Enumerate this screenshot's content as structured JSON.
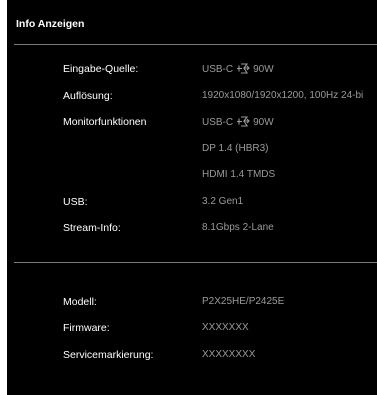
{
  "title": "Info Anzeigen",
  "rows": [
    {
      "label": "Eingabe-Quelle:",
      "value_prefix": "USB-C",
      "icon": "usb-c-power-icon",
      "value_suffix": "90W"
    },
    {
      "label": "Auflösung:",
      "value": "1920x1080/1920x1200, 100Hz 24-bi"
    },
    {
      "label": "Monitorfunktionen",
      "value_prefix": "USB-C",
      "icon": "usb-c-power-icon",
      "value_suffix": "90W"
    },
    {
      "label": "",
      "value": "DP 1.4 (HBR3)"
    },
    {
      "label": "",
      "value": "HDMI 1.4 TMDS"
    },
    {
      "label": "USB:",
      "value": "3.2 Gen1"
    },
    {
      "label": "Stream-Info:",
      "value": "8.1Gbps 2-Lane"
    },
    {
      "label": "Modell:",
      "value": "P2X25HE/P2425E"
    },
    {
      "label": "Firmware:",
      "value": "XXXXXXX"
    },
    {
      "label": "Servicemarkierung:",
      "value": "XXXXXXXX"
    }
  ]
}
